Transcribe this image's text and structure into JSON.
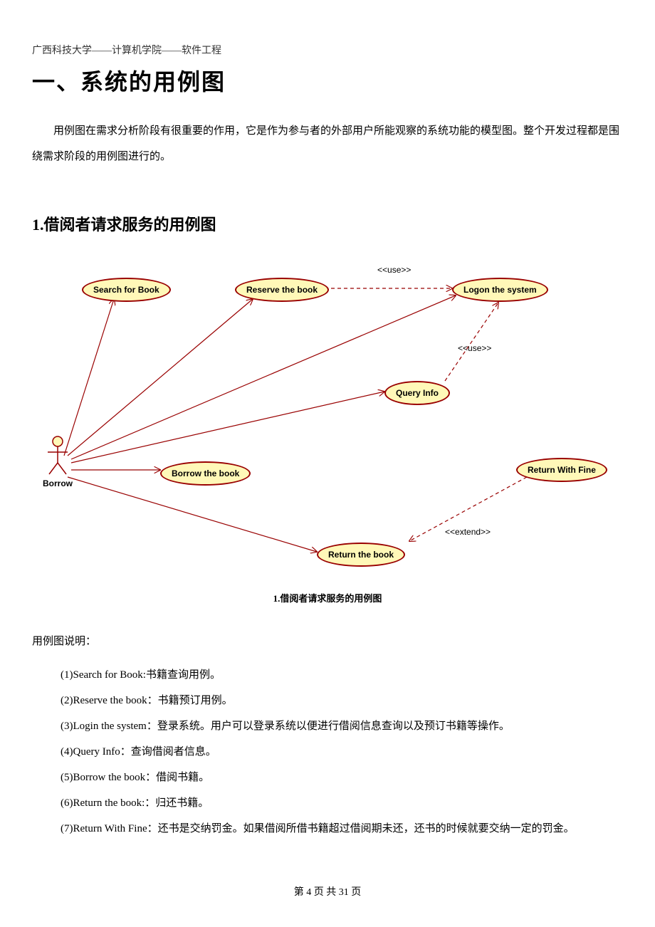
{
  "header": "广西科技大学——计算机学院——软件工程",
  "main_title": "一、系统的用例图",
  "intro": "用例图在需求分析阶段有很重要的作用，它是作为参与者的外部用户所能观察的系统功能的模型图。整个开发过程都是围绕需求阶段的用例图进行的。",
  "section_title": "1.借阅者请求服务的用例图",
  "diagram": {
    "actor_label": "Borrow",
    "usecases": {
      "search": "Search for Book",
      "reserve": "Reserve the book",
      "logon": "Logon the system",
      "query": "Query Info",
      "borrow": "Borrow the book",
      "return_fine": "Return With Fine",
      "return_book": "Return the book"
    },
    "stereotypes": {
      "use1": "<<use>>",
      "use2": "<<use>>",
      "extend": "<<extend>>"
    },
    "caption": "1.借阅者请求服务的用例图"
  },
  "explanation": {
    "title": "用例图说明：",
    "items": [
      "(1)Search for Book:书籍查询用例。",
      "(2)Reserve the book：书籍预订用例。",
      "(3)Login the system：登录系统。用户可以登录系统以便进行借阅信息查询以及预订书籍等操作。",
      "(4)Query Info：查询借阅者信息。",
      "(5)Borrow the book：借阅书籍。",
      "(6)Return the book:：归还书籍。",
      "(7)Return With Fine：还书是交纳罚金。如果借阅所借书籍超过借阅期未还，还书的时候就要交纳一定的罚金。"
    ]
  },
  "footer": "第 4 页 共 31 页"
}
